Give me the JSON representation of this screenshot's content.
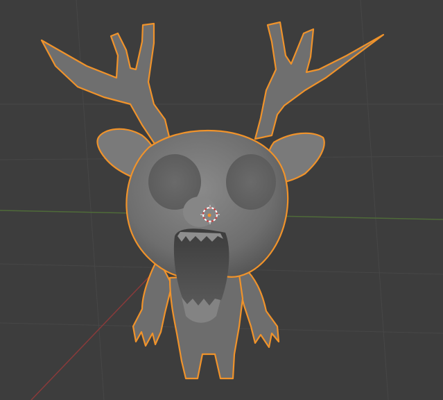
{
  "viewport": {
    "background": "#3d3d3d",
    "grid_color": "#474747",
    "x_axis_color": "#4f6b39",
    "y_axis_color": "#8a3a3a"
  },
  "model": {
    "object": "deer-character",
    "selected": true,
    "selection_outline_color": "#f0932b",
    "surface_color": "#7a7a7a",
    "shadow_color": "#4a4a4a",
    "highlight_color": "#9a9a9a"
  },
  "cursor_3d": {
    "icon": "3d-cursor-icon",
    "ring_color_a": "#ffffff",
    "ring_color_b": "#d04040"
  },
  "origin": {
    "icon": "object-origin-icon",
    "color": "#f0932b"
  }
}
